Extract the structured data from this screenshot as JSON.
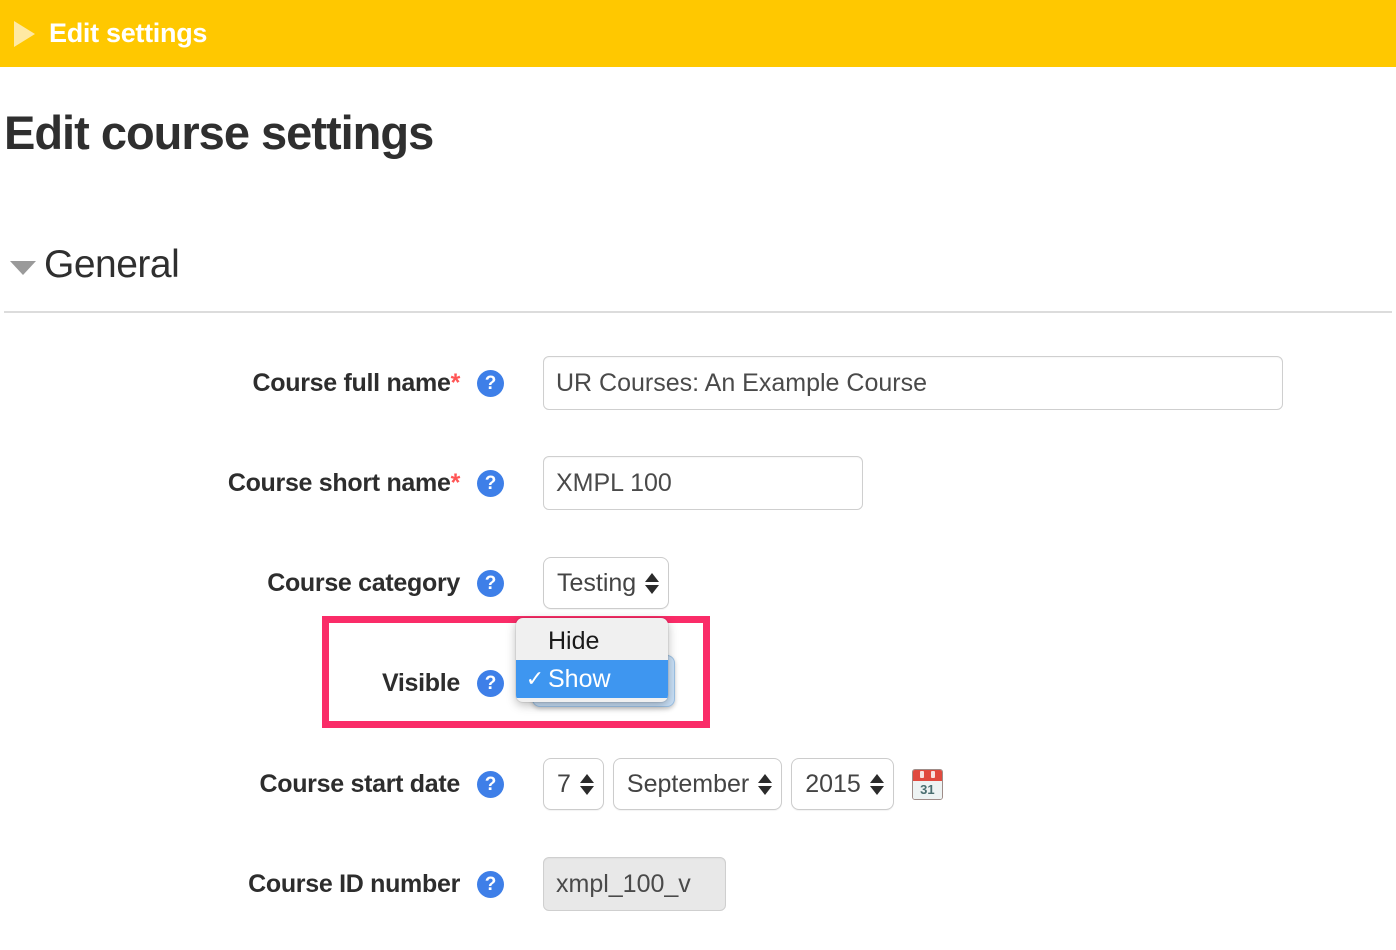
{
  "topbar": {
    "arrow_icon": "triangle-right-icon",
    "title": "Edit settings"
  },
  "page": {
    "title": "Edit course settings"
  },
  "section": {
    "caret_icon": "caret-down-icon",
    "title": "General"
  },
  "fields": {
    "full_name": {
      "label": "Course full name",
      "required_marker": "*",
      "help_icon": "?",
      "value": "UR Courses: An Example Course"
    },
    "short_name": {
      "label": "Course short name",
      "required_marker": "*",
      "help_icon": "?",
      "value": "XMPL 100"
    },
    "category": {
      "label": "Course category",
      "help_icon": "?",
      "value": "Testing"
    },
    "visible": {
      "label": "Visible",
      "help_icon": "?",
      "value": "Show",
      "options": [
        {
          "label": "Hide",
          "selected": false,
          "check": ""
        },
        {
          "label": "Show",
          "selected": true,
          "check": "✓"
        }
      ]
    },
    "start_date": {
      "label": "Course start date",
      "help_icon": "?",
      "day": "7",
      "month": "September",
      "year": "2015",
      "calendar_icon_number": "31"
    },
    "id_number": {
      "label": "Course ID number",
      "help_icon": "?",
      "value": "xmpl_100_v"
    }
  },
  "colors": {
    "topbar_background": "#ffc800",
    "highlight_border": "#fa2c68",
    "help_icon_background": "#3e7fe8",
    "dropdown_selected_background": "#3e96f0",
    "required_star": "#ff5555"
  }
}
